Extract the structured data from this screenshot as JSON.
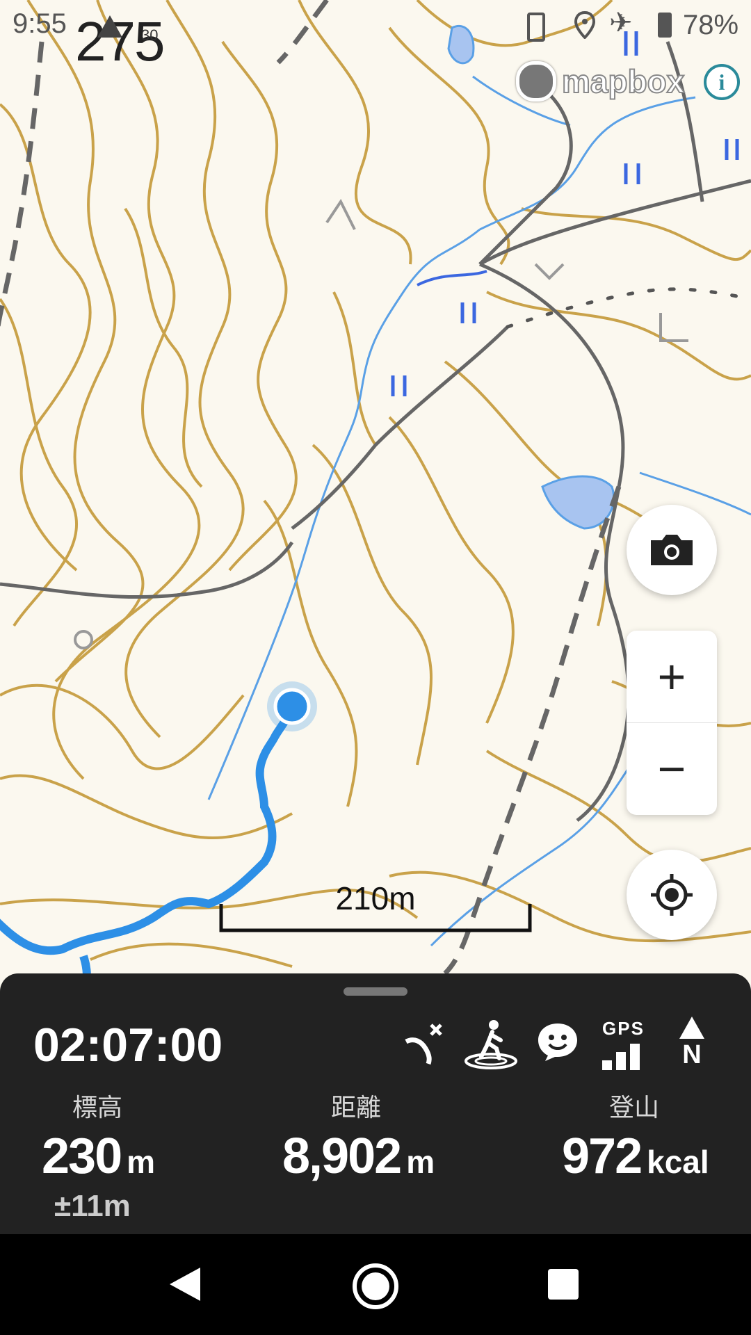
{
  "status_bar": {
    "time": "9:55",
    "elevation_overlay": "275",
    "small_badge": "30",
    "battery": "78%"
  },
  "map": {
    "attribution": "mapbox",
    "scale_label": "210m",
    "colors": {
      "contour": "#c9a24a",
      "stream": "#5aa0e6",
      "road": "#666666",
      "track": "#2d8fe6"
    }
  },
  "controls": {
    "camera_icon": "camera-icon",
    "zoom_in": "+",
    "zoom_out": "−",
    "locate_icon": "crosshair-icon"
  },
  "panel": {
    "elapsed_time": "02:07:00",
    "stats": [
      {
        "label": "標高",
        "value": "230",
        "unit": "m",
        "sub": "±11m"
      },
      {
        "label": "距離",
        "value": "8,902",
        "unit": "m"
      },
      {
        "label": "登山",
        "value": "972",
        "unit": "kcal"
      }
    ],
    "gps_label": "GPS",
    "north_label": "N"
  }
}
